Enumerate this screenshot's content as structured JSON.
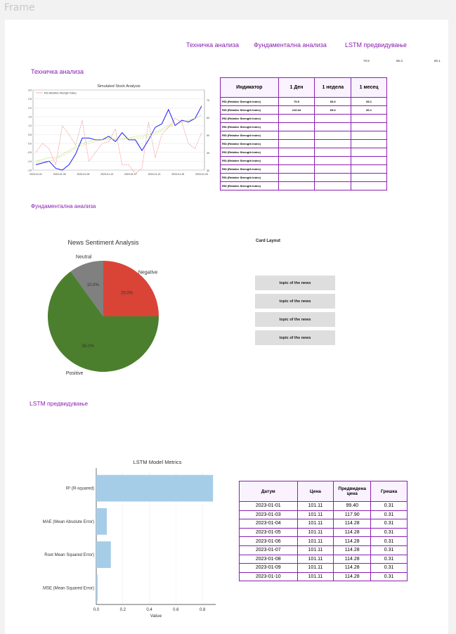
{
  "frame_label": "Frame",
  "nav": {
    "technical": "Техничка анализа",
    "fundamental": "Фундаментална анализа",
    "lstm": "LSTM предвидување"
  },
  "tiny_values": [
    "70.5",
    "65.3",
    "60.1"
  ],
  "sections": {
    "technical": "Техничка анализа",
    "fundamental": "Фундаментална анализа",
    "lstm": "LSTM предвидување"
  },
  "indicator_table": {
    "headers": [
      "Индикатор",
      "1 Ден",
      "1 недела",
      "1 месец"
    ],
    "rows": [
      [
        "RSI (Relative Strength Index)",
        "70.5",
        "65.3",
        "65.1"
      ],
      [
        "RSI (Relative Strength Index)",
        "210.34",
        "65.3",
        "60.1"
      ],
      [
        "RSI (Relative Strength Index)",
        "",
        "",
        ""
      ],
      [
        "RSI (Relative Strength Index)",
        "",
        "",
        ""
      ],
      [
        "RSI (Relative Strength Index)",
        "",
        "",
        ""
      ],
      [
        "RSI (Relative Strength Index)",
        "",
        "",
        ""
      ],
      [
        "RSI (Relative Strength Index)",
        "",
        "",
        ""
      ],
      [
        "RSI (Relative Strength Index)",
        "",
        "",
        ""
      ],
      [
        "RSI (Relative Strength Index)",
        "",
        "",
        ""
      ],
      [
        "RSI (Relative Strength Index)",
        "",
        "",
        ""
      ],
      [
        "RSI (Relative Strength Index)",
        "",
        "",
        ""
      ]
    ]
  },
  "news": {
    "card_layout_label": "Card Layout",
    "cards": [
      "topic of the news",
      "topic of the news",
      "topic of the news",
      "topic of the news"
    ]
  },
  "prediction_table": {
    "headers": [
      "Датум",
      "Цена",
      "Предвидена цена",
      "Грешка"
    ],
    "rows": [
      [
        "2023-01-01",
        "101.11",
        "99.40",
        "0.31"
      ],
      [
        "2023-01-03",
        "101.11",
        "117.90",
        "0.31"
      ],
      [
        "2023-01-04",
        "101.11",
        "114.28",
        "0.31"
      ],
      [
        "2023-01-05",
        "101.11",
        "114.28",
        "0.31"
      ],
      [
        "2023-01-06",
        "101.11",
        "114.28",
        "0.31"
      ],
      [
        "2023-01-07",
        "101.11",
        "114.28",
        "0.31"
      ],
      [
        "2023-01-08",
        "101.11",
        "114.28",
        "0.31"
      ],
      [
        "2023-01-09",
        "101.11",
        "114.28",
        "0.31"
      ],
      [
        "2023-01-10",
        "101.11",
        "114.28",
        "0.31"
      ]
    ]
  },
  "chart_data": [
    {
      "type": "line",
      "title": "Simulated Stock Analysis",
      "legend": [
        "RSI (Relative Strength Index)"
      ],
      "x": [
        "2023-01-01",
        "2023-01-05",
        "2023-01-09",
        "2023-01-13",
        "2023-01-17",
        "2023-01-21",
        "2023-01-25",
        "2023-01-29"
      ],
      "y_left_ticks": [
        "3.0",
        "2.5",
        "2.0",
        "1.5",
        "1.0",
        "0.5",
        "0.0",
        "-0.5",
        "-1.0",
        "-1.5"
      ],
      "y_right_ticks": [
        "70",
        "60",
        "50",
        "40",
        "30"
      ],
      "ylim": [
        -1.5,
        3.0
      ],
      "series": [
        {
          "color": "#1a1aff",
          "values": [
            -1.2,
            -1.1,
            -1.0,
            -1.4,
            -1.5,
            -1.2,
            -0.6,
            0.3,
            0.3,
            0.2,
            0.2,
            0.4,
            0.1,
            0.6,
            0.2,
            0.2,
            -0.4,
            0.2,
            0.9,
            1.1,
            1.9,
            1.0,
            1.3,
            1.2,
            1.4,
            2.1
          ]
        },
        {
          "color": "#f08080",
          "values": [
            -0.5,
            0.0,
            -0.3,
            -1.2,
            1.0,
            0.5,
            -0.1,
            1.3,
            -1.0,
            -0.5,
            0.0,
            0.1,
            0.8,
            -1.2,
            -1.2,
            -1.7,
            -1.4,
            1.2,
            -0.8,
            0.5,
            0.9,
            1.4,
            1.2,
            0.0,
            -0.3,
            0.6
          ]
        },
        {
          "color": "#9acd32",
          "values": [
            -1.0,
            -0.9,
            -0.8,
            -0.8,
            -0.6,
            -0.4,
            -0.2,
            0.0,
            0.1,
            0.2,
            0.2,
            0.3,
            0.2,
            0.2,
            0.3,
            0.4,
            0.4,
            0.5,
            0.6,
            0.8,
            1.0,
            1.1,
            1.2,
            1.3,
            1.4,
            1.6
          ]
        },
        {
          "color": "#cccc66",
          "values": [
            -1.1,
            -1.0,
            -1.0,
            -0.9,
            -0.7,
            -0.5,
            -0.3,
            -0.1,
            0.0,
            0.1,
            0.2,
            0.2,
            0.3,
            0.3,
            0.3,
            0.3,
            0.3,
            0.4,
            0.5,
            0.7,
            0.9,
            1.0,
            1.2,
            1.3,
            1.4,
            1.6
          ]
        }
      ]
    },
    {
      "type": "pie",
      "title": "News Sentiment Analysis",
      "slices": [
        {
          "label": "Negative",
          "value": 25.0,
          "pct": "25.0%",
          "color": "#d94436"
        },
        {
          "label": "Positive",
          "value": 65.0,
          "pct": "65.0%",
          "color": "#4b7f2e"
        },
        {
          "label": "Neutral",
          "value": 10.0,
          "pct": "10.0%",
          "color": "#808080"
        }
      ]
    },
    {
      "type": "bar",
      "title": "LSTM Model Metrics",
      "orientation": "horizontal",
      "categories": [
        "R² (R-squared)",
        "MAE (Mean Absolute Error)",
        "Root Mean Squared Error)",
        "MSE (Mean Squared Error)"
      ],
      "values": [
        0.88,
        0.08,
        0.11,
        0.01
      ],
      "xlabel": "Value",
      "xlim": [
        0.0,
        0.9
      ],
      "x_ticks": [
        "0.0",
        "0.2",
        "0.4",
        "0.6",
        "0.8"
      ],
      "color": "#a6cde8"
    }
  ]
}
